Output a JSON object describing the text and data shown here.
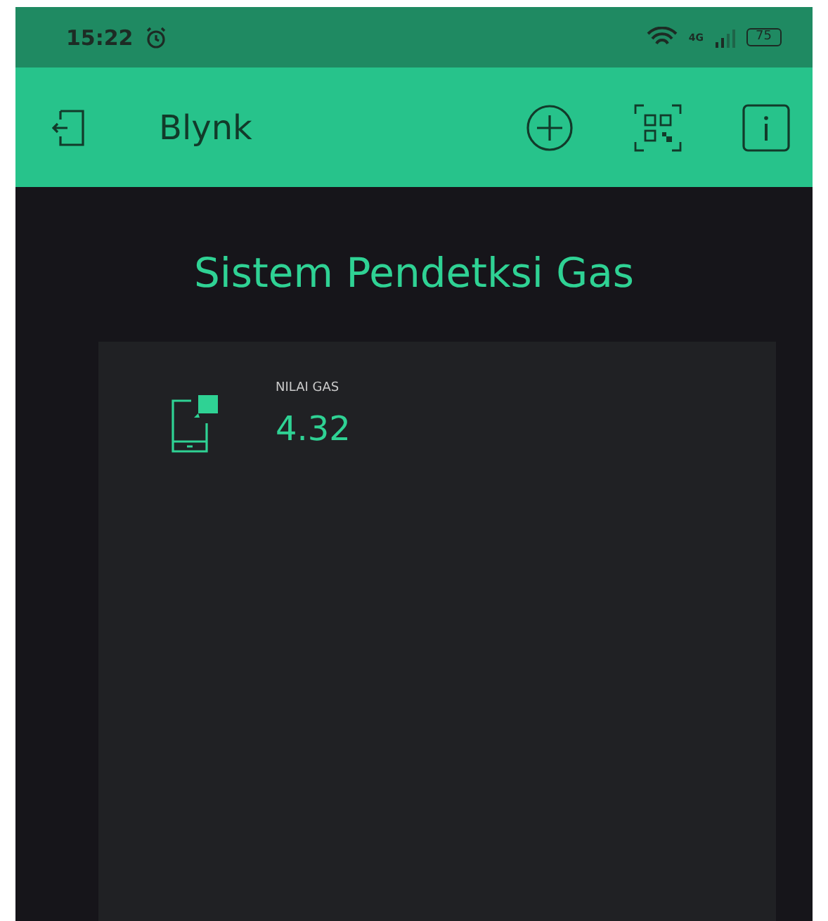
{
  "status_bar": {
    "time": "15:22",
    "network": "4G",
    "battery": "75"
  },
  "app_bar": {
    "title": "Blynk"
  },
  "project": {
    "title": "Sistem Pendetksi Gas"
  },
  "widgets": [
    {
      "kind": "value_display",
      "label": "NILAI GAS",
      "value": "4.32"
    }
  ]
}
